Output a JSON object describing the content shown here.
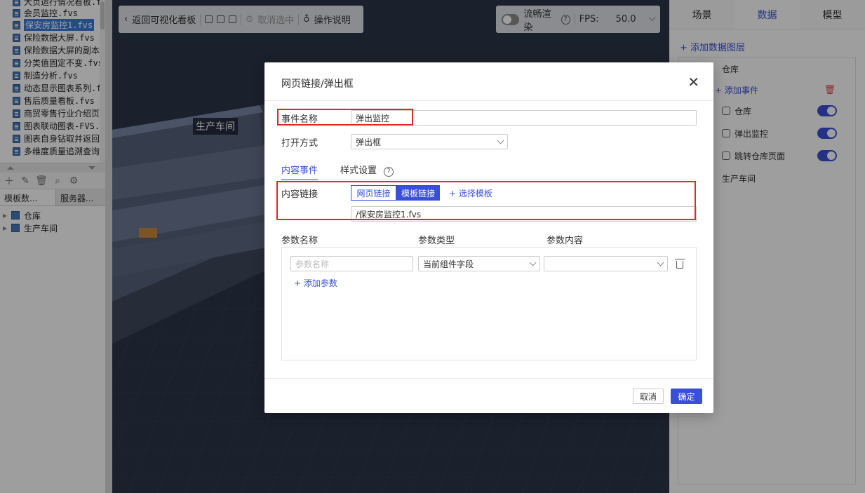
{
  "left_panel": {
    "files": [
      {
        "name": "大页运行情况看板.f"
      },
      {
        "name": "会员监控.fvs"
      },
      {
        "name": "保安房监控1.fvs",
        "selected": true
      },
      {
        "name": "保险数据大屏.fvs"
      },
      {
        "name": "保险数据大屏的副本"
      },
      {
        "name": "分类值固定不变.fvs"
      },
      {
        "name": "制造分析.fvs"
      },
      {
        "name": "动态显示图表系列.f"
      },
      {
        "name": "售后质量看板.fvs"
      },
      {
        "name": "商贸零售行业介绍页"
      },
      {
        "name": "图表联动图表-FVS.f"
      },
      {
        "name": "图表自身钻取并返回"
      },
      {
        "name": "多维度质量追溯查询"
      }
    ],
    "tabs": [
      "模板数...",
      "服务器..."
    ],
    "tree": [
      "仓库",
      "生产车间"
    ]
  },
  "toolbar": {
    "back_label": "返回可视化看板",
    "deselect_label": "取消选中",
    "help_label": "操作说明"
  },
  "render_bar": {
    "smooth_label": "流畅渲染",
    "fps_label": "FPS:",
    "fps_value": "50.0"
  },
  "scene": {
    "label": "生产车间"
  },
  "right_panel": {
    "tabs": [
      "场景",
      "数据",
      "模型"
    ],
    "active_tab": "数据",
    "add_layer_label": "+ 添加数据图层",
    "layer_name": "仓库",
    "add_event_label": "+ 添加事件",
    "events": [
      {
        "label": "仓库",
        "on": true
      },
      {
        "label": "弹出监控",
        "on": true
      },
      {
        "label": "跳转仓库页面",
        "on": true
      }
    ],
    "layer_name_2": "生产车间"
  },
  "dialog": {
    "title": "网页链接/弹出框",
    "event_name_label": "事件名称",
    "event_name_value": "弹出监控",
    "open_mode_label": "打开方式",
    "open_mode_value": "弹出框",
    "tab_content": "内容事件",
    "tab_style": "样式设置",
    "content_link_label": "内容链接",
    "seg_web": "网页链接",
    "seg_tpl": "模板链接",
    "choose_tpl": "+ 选择模板",
    "link_value": "/保安房监控1.fvs",
    "param_name_head": "参数名称",
    "param_type_head": "参数类型",
    "param_content_head": "参数内容",
    "param_name_placeholder": "参数名称",
    "param_type_value": "当前组件字段",
    "add_param": "+ 添加参数",
    "cancel": "取消",
    "ok": "确定"
  },
  "colors": {
    "accent": "#3a4fd8",
    "highlight_red": "#e02828"
  }
}
